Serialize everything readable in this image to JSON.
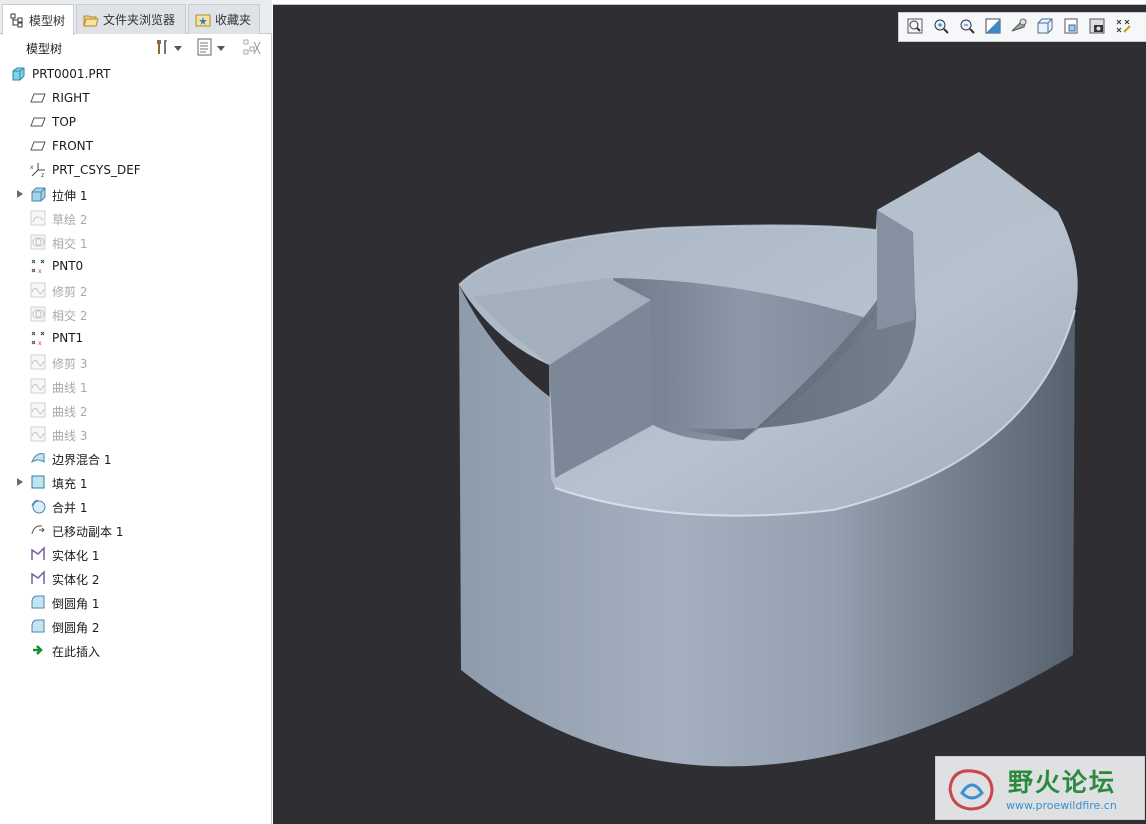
{
  "tabs": [
    {
      "label": "模型树",
      "icon": "model-tree-icon",
      "active": true
    },
    {
      "label": "文件夹浏览器",
      "icon": "folder-icon",
      "active": false
    },
    {
      "label": "收藏夹",
      "icon": "favorites-icon",
      "active": false
    }
  ],
  "tree_header": {
    "title": "模型树"
  },
  "tree": {
    "root": {
      "label": "PRT0001.PRT",
      "icon": "part-icon"
    },
    "items": [
      {
        "label": "RIGHT",
        "icon": "datum-plane-icon",
        "dim": false,
        "expandable": false
      },
      {
        "label": "TOP",
        "icon": "datum-plane-icon",
        "dim": false,
        "expandable": false
      },
      {
        "label": "FRONT",
        "icon": "datum-plane-icon",
        "dim": false,
        "expandable": false
      },
      {
        "label": "PRT_CSYS_DEF",
        "icon": "csys-icon",
        "dim": false,
        "expandable": false
      },
      {
        "label": "拉伸 1",
        "icon": "extrude-icon",
        "dim": false,
        "expandable": true
      },
      {
        "label": "草绘 2",
        "icon": "sketch-icon",
        "dim": true,
        "expandable": false
      },
      {
        "label": "相交 1",
        "icon": "intersect-icon",
        "dim": true,
        "expandable": false
      },
      {
        "label": "PNT0",
        "icon": "datum-point-icon",
        "dim": false,
        "expandable": false
      },
      {
        "label": "修剪 2",
        "icon": "curve-icon",
        "dim": true,
        "expandable": false
      },
      {
        "label": "相交 2",
        "icon": "intersect-icon",
        "dim": true,
        "expandable": false
      },
      {
        "label": "PNT1",
        "icon": "datum-point-icon",
        "dim": false,
        "expandable": false
      },
      {
        "label": "修剪 3",
        "icon": "curve-icon",
        "dim": true,
        "expandable": false
      },
      {
        "label": "曲线 1",
        "icon": "curve-icon",
        "dim": true,
        "expandable": false
      },
      {
        "label": "曲线 2",
        "icon": "curve-icon",
        "dim": true,
        "expandable": false
      },
      {
        "label": "曲线 3",
        "icon": "curve-icon",
        "dim": true,
        "expandable": false
      },
      {
        "label": "边界混合 1",
        "icon": "boundary-blend-icon",
        "dim": false,
        "expandable": false
      },
      {
        "label": "填充 1",
        "icon": "fill-icon",
        "dim": false,
        "expandable": true
      },
      {
        "label": "合并 1",
        "icon": "merge-icon",
        "dim": false,
        "expandable": false
      },
      {
        "label": "已移动副本 1",
        "icon": "moved-copy-icon",
        "dim": false,
        "expandable": false
      },
      {
        "label": "实体化 1",
        "icon": "solidify-icon",
        "dim": false,
        "expandable": false
      },
      {
        "label": "实体化 2",
        "icon": "solidify-icon",
        "dim": false,
        "expandable": false
      },
      {
        "label": "倒圆角 1",
        "icon": "round-icon",
        "dim": false,
        "expandable": false
      },
      {
        "label": "倒圆角 2",
        "icon": "round-icon",
        "dim": false,
        "expandable": false
      },
      {
        "label": "在此插入",
        "icon": "insert-here-icon",
        "dim": false,
        "expandable": false
      }
    ]
  },
  "view_toolbar": [
    {
      "name": "refit-icon"
    },
    {
      "name": "zoom-in-icon"
    },
    {
      "name": "zoom-out-icon"
    },
    {
      "name": "repaint-icon"
    },
    {
      "name": "perspective-icon"
    },
    {
      "name": "display-style-icon"
    },
    {
      "name": "saved-orientations-icon"
    },
    {
      "name": "view-manager-icon"
    },
    {
      "name": "datum-display-icon"
    }
  ],
  "watermark": {
    "title": "野火论坛",
    "url": "www.proewildfire.cn"
  },
  "colors": {
    "viewport_bg": "#2e2e33",
    "model_light": "#b3bfcd",
    "model_mid": "#95a2b2",
    "model_dark": "#55616f",
    "watermark_green": "#2c8a3e",
    "watermark_blue": "#3a8fd0"
  }
}
